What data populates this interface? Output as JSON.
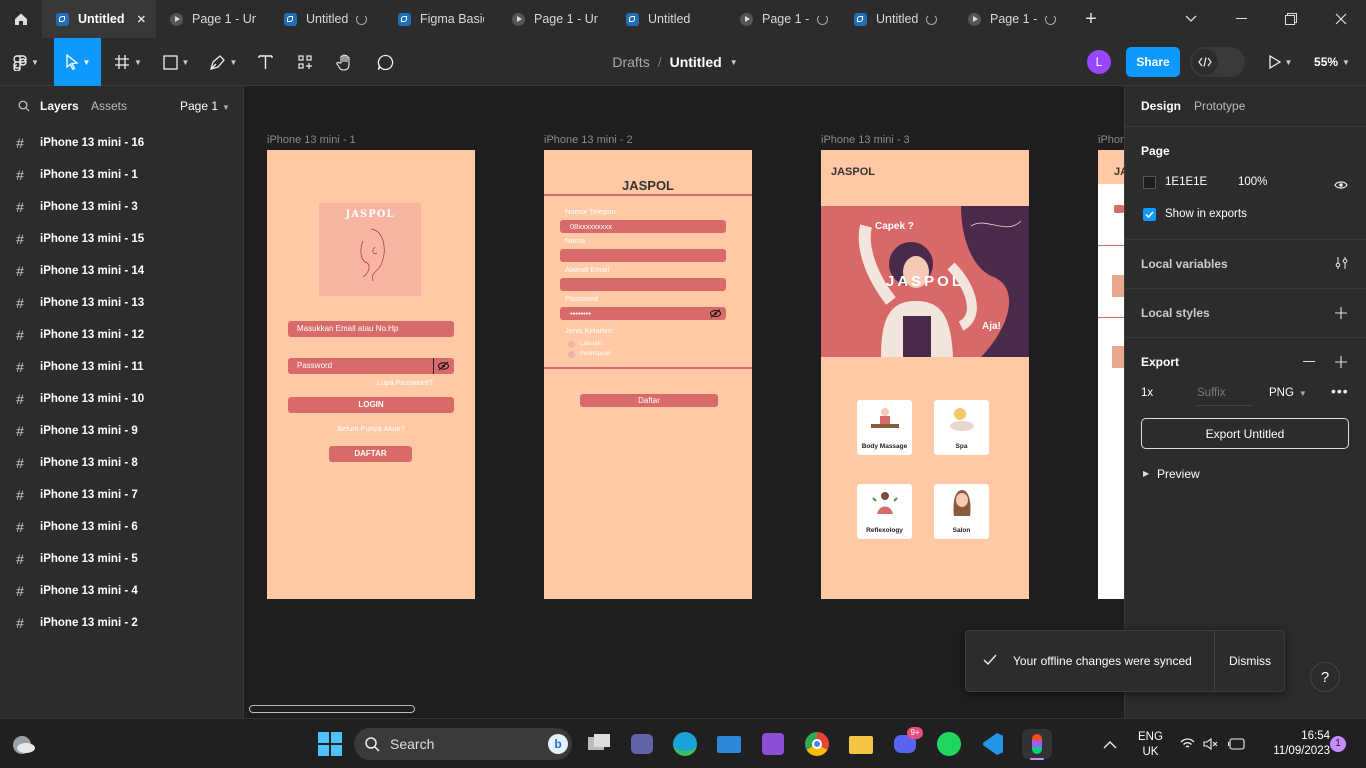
{
  "tabs": [
    {
      "label": "Untitled",
      "kind": "file",
      "active": true
    },
    {
      "label": "Page 1 - Un",
      "kind": "proto"
    },
    {
      "label": "Untitled",
      "kind": "file"
    },
    {
      "label": "Figma Basic",
      "kind": "file"
    },
    {
      "label": "Page 1 - Un",
      "kind": "proto"
    },
    {
      "label": "Untitled",
      "kind": "file"
    },
    {
      "label": "Page 1 -",
      "kind": "proto"
    },
    {
      "label": "Untitled",
      "kind": "file"
    },
    {
      "label": "Page 1 -",
      "kind": "proto"
    }
  ],
  "breadcrumb": {
    "folder": "Drafts",
    "sep": "/",
    "file": "Untitled"
  },
  "toolbar": {
    "avatar": "L",
    "share": "Share",
    "zoom": "55%"
  },
  "left_panel": {
    "tab_layers": "Layers",
    "tab_assets": "Assets",
    "page": "Page 1",
    "layers": [
      "iPhone 13 mini - 16",
      "iPhone 13 mini - 1",
      "iPhone 13 mini - 3",
      "iPhone 13 mini - 15",
      "iPhone 13 mini - 14",
      "iPhone 13 mini - 13",
      "iPhone 13 mini - 12",
      "iPhone 13 mini - 11",
      "iPhone 13 mini - 10",
      "iPhone 13 mini - 9",
      "iPhone 13 mini - 8",
      "iPhone 13 mini - 7",
      "iPhone 13 mini - 6",
      "iPhone 13 mini - 5",
      "iPhone 13 mini - 4",
      "iPhone 13 mini - 2"
    ]
  },
  "canvas": {
    "frame_labels": [
      "iPhone 13 mini - 1",
      "iPhone 13 mini - 2",
      "iPhone 13 mini - 3",
      "iPhone"
    ],
    "frame1": {
      "logo": "JASPOL",
      "email_ph": "Masukkan Email atau No.Hp",
      "password_ph": "Password",
      "forgot": "Lupa Password?",
      "login": "LOGIN",
      "no_account": "Belum Punya Akun?",
      "register": "DAFTAR"
    },
    "frame2": {
      "title": "JASPOL",
      "phone_label": "Nomor Telepon",
      "phone_value": "08xxxxxxxxx",
      "name_label": "Nama",
      "email_label": "Alamat Email",
      "password_label": "Password",
      "password_value": "••••••••",
      "gender_label": "Jenis Kelamin:",
      "male": "Laki-laki",
      "female": "Perempuan",
      "submit": "Daftar"
    },
    "frame3": {
      "header": "JASPOL",
      "banner_q": "Capek ?",
      "banner_brand": "JASPOL",
      "banner_cta": "Aja!",
      "services": [
        "Body Massage",
        "Spa",
        "Reflexology",
        "Salon"
      ]
    },
    "frame4": {
      "header": "JA"
    }
  },
  "right_panel": {
    "tab_design": "Design",
    "tab_prototype": "Prototype",
    "page_title": "Page",
    "bg_hex": "1E1E1E",
    "bg_opacity": "100%",
    "show_exports": "Show in exports",
    "local_variables": "Local variables",
    "local_styles": "Local styles",
    "export": "Export",
    "scale": "1x",
    "suffix_placeholder": "Suffix",
    "format": "PNG",
    "export_button": "Export Untitled",
    "preview": "Preview"
  },
  "toast": {
    "message": "Your offline changes were synced",
    "dismiss": "Dismiss"
  },
  "help": "?",
  "taskbar": {
    "search": "Search",
    "lang1": "ENG",
    "lang2": "UK",
    "time": "16:54",
    "date": "11/09/2023",
    "notif": "1",
    "discord_badge": "9+"
  },
  "colors": {
    "accent": "#0d99ff",
    "frame_bg": "#ffc9a5",
    "button": "#d96a6a",
    "banner": "#d96868",
    "purple": "#4a2a4a"
  }
}
